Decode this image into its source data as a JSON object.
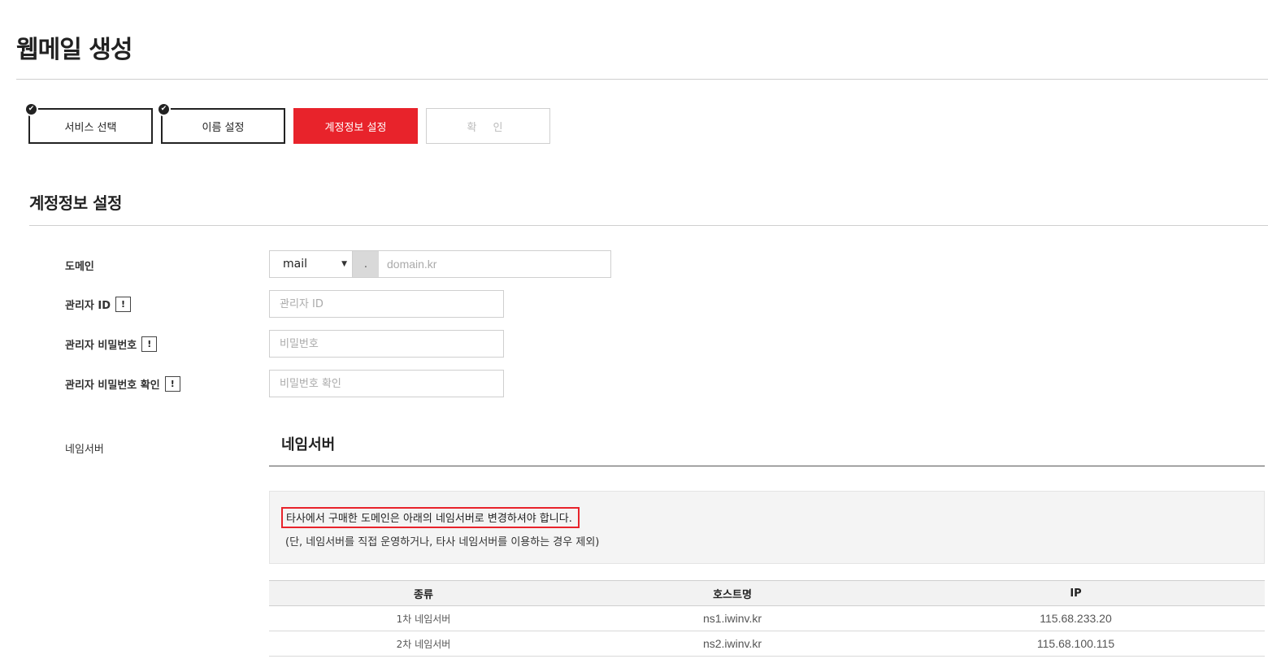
{
  "page": {
    "title": "웹메일 생성"
  },
  "steps": [
    {
      "label": "서비스 선택",
      "state": "done"
    },
    {
      "label": "이름 설정",
      "state": "done"
    },
    {
      "label": "계정정보 설정",
      "state": "active"
    },
    {
      "label": "확 인",
      "state": "disabled"
    }
  ],
  "section": {
    "title": "계정정보 설정"
  },
  "form": {
    "domain": {
      "label": "도메인",
      "select_value": "mail",
      "separator": ".",
      "placeholder": "domain.kr"
    },
    "admin_id": {
      "label": "관리자 ID",
      "placeholder": "관리자 ID"
    },
    "admin_password": {
      "label": "관리자 비밀번호",
      "placeholder": "비밀번호"
    },
    "admin_password_confirm": {
      "label": "관리자 비밀번호 확인",
      "placeholder": "비밀번호 확인"
    },
    "info_glyph": "!"
  },
  "nameserver": {
    "label": "네임서버",
    "title": "네임서버",
    "notice_main": "타사에서 구매한 도메인은 아래의 네임서버로 변경하셔야 합니다.",
    "notice_sub": "(단, 네임서버를 직접 운영하거나, 타사 네임서버를 이용하는 경우 제외)",
    "columns": [
      "종류",
      "호스트명",
      "IP"
    ],
    "rows": [
      {
        "type": "1차 네임서버",
        "host": "ns1.iwinv.kr",
        "ip": "115.68.233.20"
      },
      {
        "type": "2차 네임서버",
        "host": "ns2.iwinv.kr",
        "ip": "115.68.100.115"
      }
    ]
  },
  "colors": {
    "accent": "#e8232b",
    "border": "#cfcfcf",
    "notice_bg": "#f4f4f4"
  },
  "icons": {
    "step_done": "check-circle-icon",
    "select_caret": "caret-down-icon",
    "info": "exclamation-icon"
  }
}
